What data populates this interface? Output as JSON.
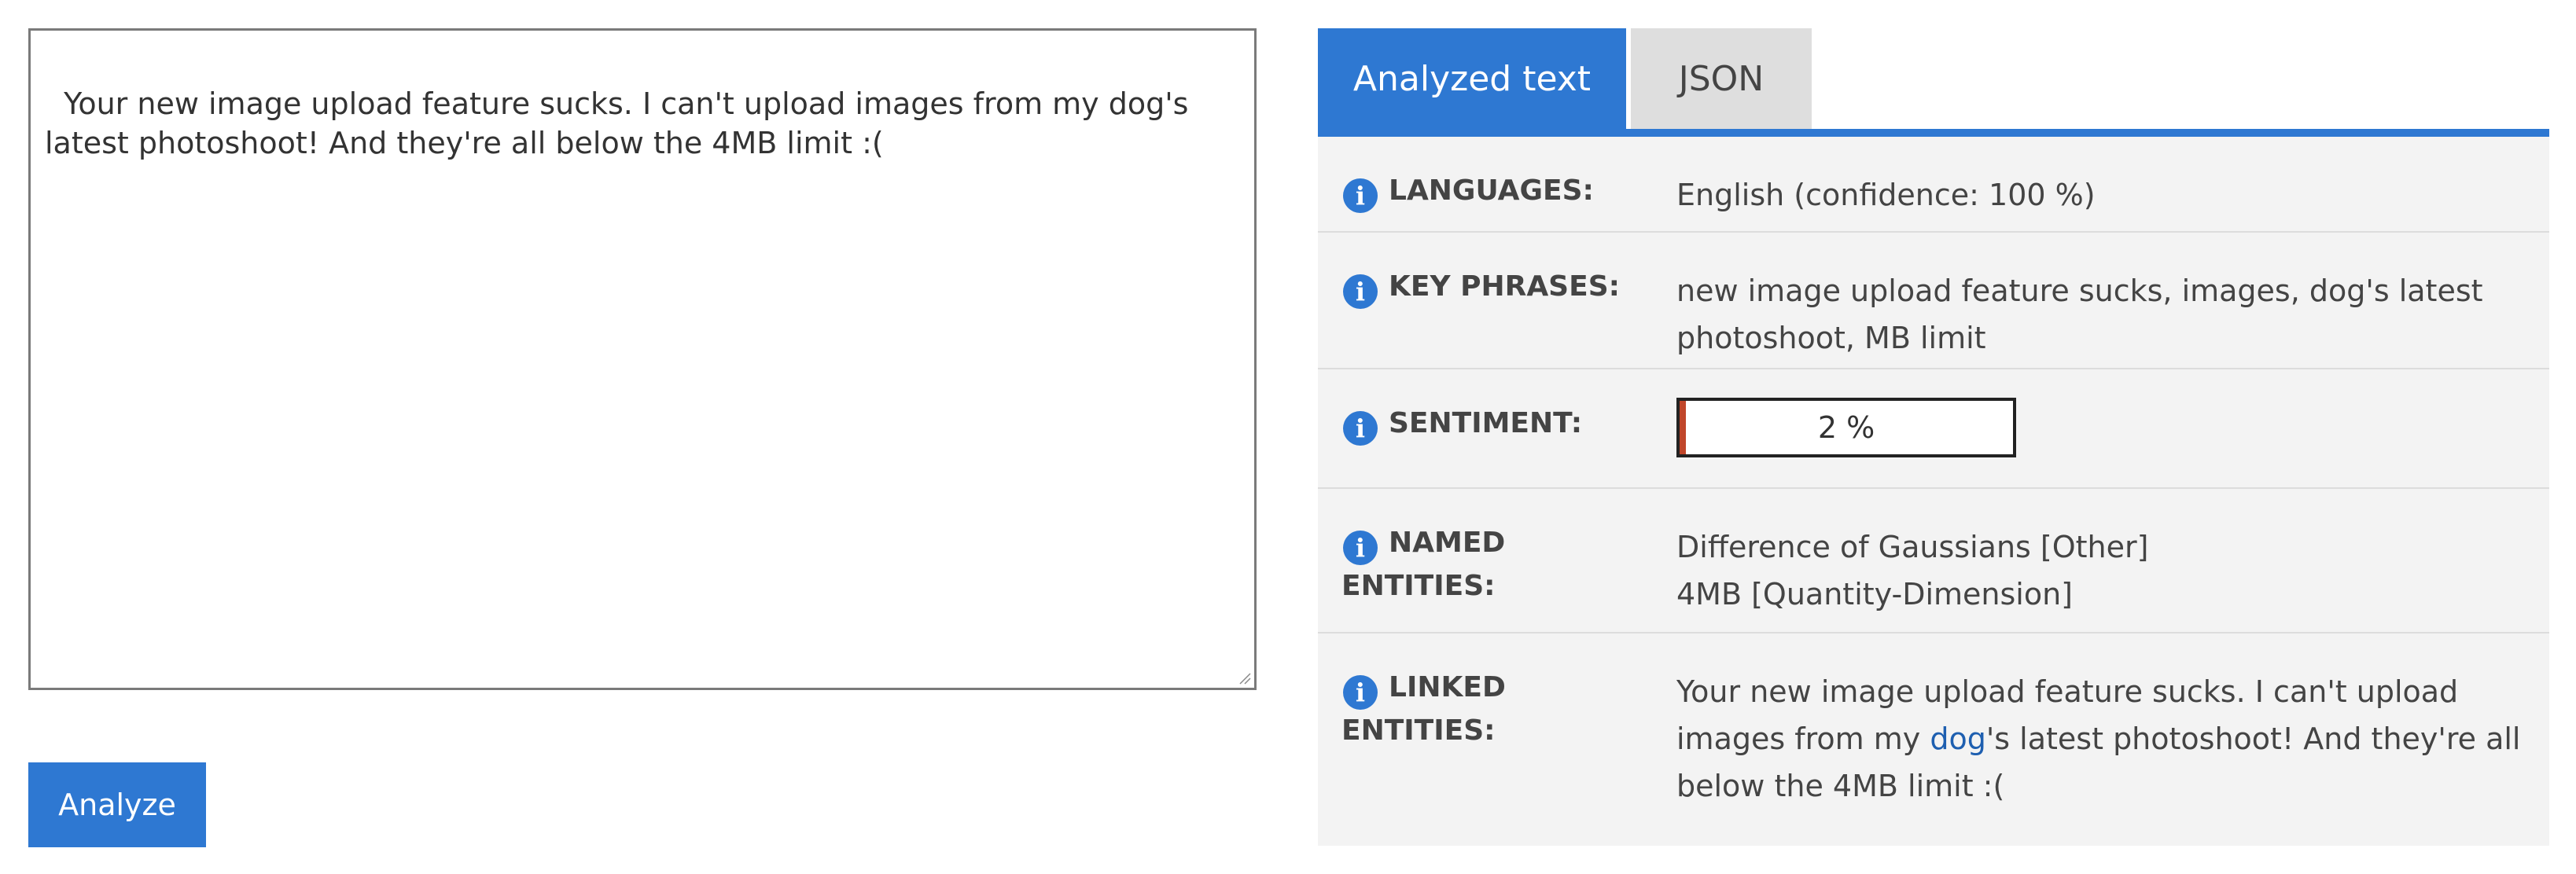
{
  "input": {
    "text": "Your new image upload feature sucks. I can't upload images from my dog's latest photoshoot! And they're all below the 4MB limit :("
  },
  "analyze_button": {
    "label": "Analyze"
  },
  "tabs": [
    {
      "label": "Analyzed text",
      "active": true
    },
    {
      "label": "JSON",
      "active": false
    }
  ],
  "results": {
    "languages": {
      "label": "LANGUAGES:",
      "value": "English (confidence: 100 %)"
    },
    "key_phrases": {
      "label": "KEY PHRASES:",
      "value": "new image upload feature sucks, images, dog's latest photoshoot, MB limit"
    },
    "sentiment": {
      "label": "SENTIMENT:",
      "score_percent": 2,
      "text": "2 %",
      "fill_color": "#c0462a"
    },
    "named_entities": {
      "label": "NAMED ENTITIES:",
      "items": [
        "Difference of Gaussians [Other]",
        "4MB [Quantity-Dimension]"
      ]
    },
    "linked_entities": {
      "label": "LINKED ENTITIES:",
      "text_before": "Your new image upload feature sucks. I can't upload images from my ",
      "link_text": "dog",
      "text_after": "'s latest photoshoot! And they're all below the 4MB limit :("
    }
  },
  "colors": {
    "accent": "#2e78d2",
    "panel_bg": "#f3f3f3",
    "inactive_tab": "#dedede",
    "link": "#1e5fb0"
  },
  "icons": {
    "info": "info-icon",
    "resize": "resize-grip-icon"
  }
}
